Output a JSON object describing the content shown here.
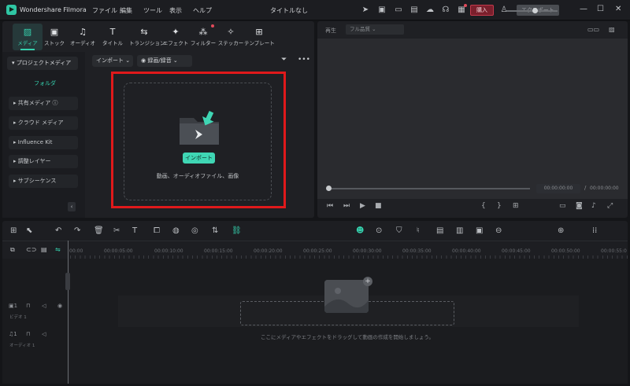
{
  "titlebar": {
    "app_name": "Wondershare Filmora",
    "menu": [
      "ファイル",
      "編集",
      "ツール",
      "表示",
      "ヘルプ"
    ],
    "window_title": "タイトルなし",
    "buy_label": "購入",
    "export_label": "エクスポート"
  },
  "media_tabs": [
    {
      "label": "メディア",
      "icon": "media-icon",
      "active": true
    },
    {
      "label": "ストック",
      "icon": "stock-icon"
    },
    {
      "label": "オーディオ",
      "icon": "music-icon"
    },
    {
      "label": "タイトル",
      "icon": "title-icon"
    },
    {
      "label": "トランジション",
      "icon": "transition-icon"
    },
    {
      "label": "エフェクト",
      "icon": "effect-icon"
    },
    {
      "label": "フィルター",
      "icon": "filter-icon"
    },
    {
      "label": "ステッカー",
      "icon": "sticker-icon"
    },
    {
      "label": "テンプレート",
      "icon": "template-icon"
    }
  ],
  "sidebar": {
    "project_media": "プロジェクトメディア",
    "folder": "フォルダ",
    "items": [
      "共有メディア",
      "クラウド メディア",
      "Influence Kit",
      "調整レイヤー",
      "サブシーケンス"
    ]
  },
  "media_toolbar": {
    "import_dropdown": "インポート",
    "record_dropdown": "録画/録音"
  },
  "drop_zone": {
    "import_button": "インポート",
    "hint": "動画、オーディオファイル、画像"
  },
  "preview": {
    "label": "再生",
    "quality": "フル品質",
    "current_time": "00:00:00:00",
    "separator": "/",
    "total_time": "00:00:00:00"
  },
  "timeline": {
    "ruler": [
      "00:00",
      "00:00:05:00",
      "00:00:10:00",
      "00:00:15:00",
      "00:00:20:00",
      "00:00:25:00",
      "00:00:30:00",
      "00:00:35:00",
      "00:00:40:00",
      "00:00:45:00",
      "00:00:50:00",
      "00:00:55:0"
    ],
    "video_track": "ビデオ 1",
    "audio_track": "オーディオ 1",
    "drop_hint": "ここにメディアやエフェクトをドラッグして動画の作成を開始しましょう。"
  },
  "colors": {
    "accent": "#35d1ae",
    "highlight": "#e0191b",
    "buy": "#7a1f2c"
  }
}
